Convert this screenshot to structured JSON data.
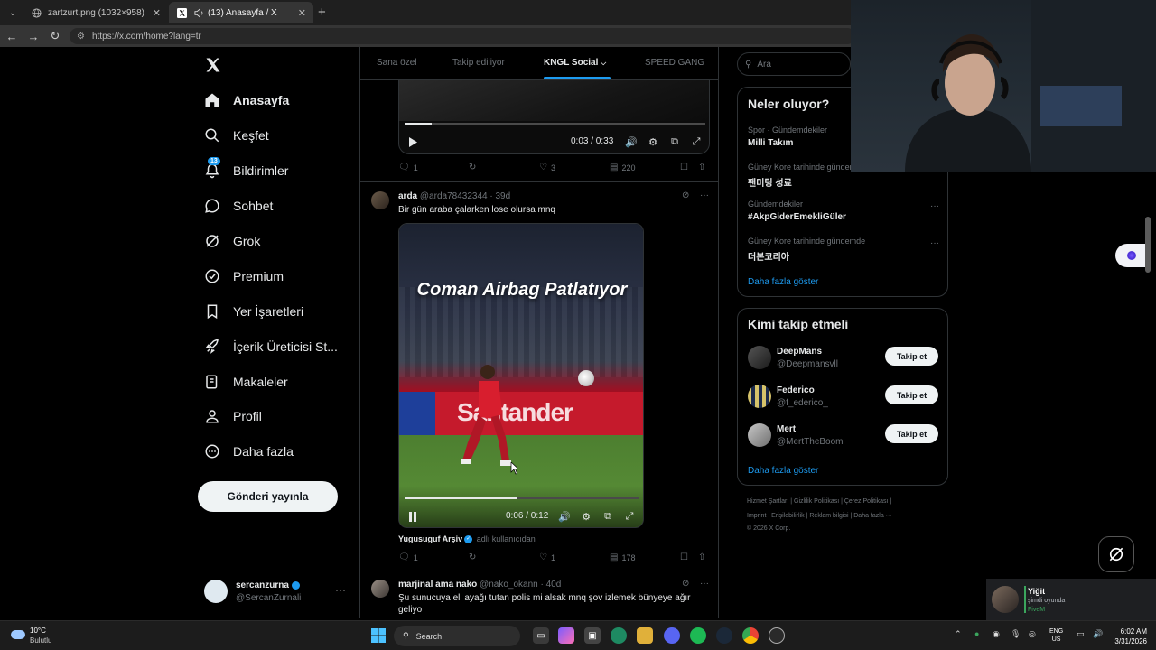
{
  "browser": {
    "tabs": [
      {
        "title": "zartzurt.png (1032×958)",
        "icon": "globe-icon"
      },
      {
        "title": "(13) Anasayfa / X",
        "icon": "x-logo-icon",
        "audio": true
      }
    ],
    "url": "https://x.com/home?lang=tr"
  },
  "sidebar": {
    "items": [
      {
        "label": "Anasayfa",
        "icon": "home-icon",
        "active": true
      },
      {
        "label": "Keşfet",
        "icon": "search-icon"
      },
      {
        "label": "Bildirimler",
        "icon": "bell-icon",
        "badge": "13"
      },
      {
        "label": "Sohbet",
        "icon": "chat-icon"
      },
      {
        "label": "Grok",
        "icon": "grok-icon"
      },
      {
        "label": "Premium",
        "icon": "premium-icon"
      },
      {
        "label": "Yer İşaretleri",
        "icon": "bookmark-icon"
      },
      {
        "label": "İçerik Üreticisi St...",
        "icon": "rocket-icon"
      },
      {
        "label": "Makaleler",
        "icon": "article-icon"
      },
      {
        "label": "Profil",
        "icon": "person-icon"
      },
      {
        "label": "Daha fazla",
        "icon": "more-circle-icon"
      }
    ],
    "post_button": "Gönderi yayınla",
    "account": {
      "name": "sercanzurna",
      "handle": "@SercanZurnali",
      "more": "···"
    }
  },
  "feed": {
    "tabs": [
      "Sana özel",
      "Takip ediliyor",
      "KNGL Social",
      "SPEED GANG"
    ],
    "active_tab": "KNGL Social",
    "video1": {
      "time": "0:03 / 0:33",
      "progress": 0.09
    },
    "video1_actions": {
      "replies": "1",
      "reposts": "",
      "likes": "3",
      "views": "220"
    },
    "tweet2": {
      "name": "arda",
      "handle": "@arda78432344 · 39d",
      "text": "Bir gün araba çalarken lose olursa mnq",
      "video_title": "Coman Airbag Patlatıyor",
      "board_text": "Santander",
      "time": "0:06 / 0:12",
      "progress": 0.48,
      "source_name": "Yugusuguf Arşiv",
      "source_desc": "adlı kullanıcıdan",
      "actions": {
        "replies": "1",
        "reposts": "",
        "likes": "1",
        "views": "178"
      }
    },
    "tweet3": {
      "name": "marjinal ama nako",
      "handle": "@nako_okann · 40d",
      "text": "Şu sunucuya eli ayağı tutan polis mi alsak mnq şov izlemek bünyeye ağır geliyo"
    }
  },
  "right": {
    "search_placeholder": "Ara",
    "trends_title": "Neler oluyor?",
    "trends": [
      {
        "context": "Spor · Gündemdekiler",
        "name": "Milli Takım"
      },
      {
        "context": "Güney Kore tarihinde gündemde",
        "name": "팬미팅 성료"
      },
      {
        "context": "Gündemdekiler",
        "name": "#AkpGiderEmekliGüler"
      },
      {
        "context": "Güney Kore tarihinde gündemde",
        "name": "더본코리아"
      }
    ],
    "trends_more": "Daha fazla göster",
    "follow_title": "Kimi takip etmeli",
    "follow": [
      {
        "name": "DeepMans",
        "handle": "@Deepmansvll",
        "button": "Takip et"
      },
      {
        "name": "Federico",
        "handle": "@f_ederico_",
        "button": "Takip et"
      },
      {
        "name": "Mert",
        "handle": "@MertTheBoom",
        "button": "Takip et"
      }
    ],
    "follow_more": "Daha fazla göster",
    "footer_line1": "Hizmet Şartları  |  Gizlilik Politikası  |  Çerez Politikası  |",
    "footer_line2": "Imprint  |  Erişilebilirlik  |  Reklam bilgisi  |  Daha fazla ···",
    "footer_line3": "© 2026 X Corp."
  },
  "discord_popup": {
    "name": "Yiğit",
    "status": "şimdi oyunda",
    "game": "FiveM"
  },
  "taskbar": {
    "weather_temp": "10°C",
    "weather_desc": "Bulutlu",
    "search_label": "Search",
    "lang_line1": "ENG",
    "lang_line2": "US",
    "time": "6:02 AM",
    "date": "3/31/2026"
  }
}
